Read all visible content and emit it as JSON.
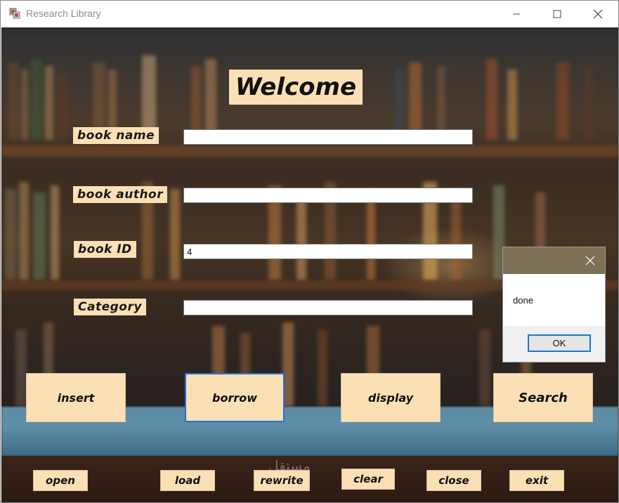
{
  "window": {
    "title": "Research Library",
    "controls": {
      "minimize": "minimize",
      "maximize": "maximize",
      "close": "close"
    }
  },
  "form": {
    "heading": "Welcome",
    "fields": [
      {
        "label": "book name",
        "value": ""
      },
      {
        "label": "book author",
        "value": ""
      },
      {
        "label": "book ID",
        "value": "4"
      },
      {
        "label": "Category",
        "value": ""
      }
    ]
  },
  "actions": {
    "main": [
      "insert",
      "borrow",
      "display",
      "Search"
    ],
    "secondary": [
      "open",
      "load",
      "rewrite",
      "clear",
      "close",
      "exit"
    ]
  },
  "dialog": {
    "message": "done",
    "ok_label": "OK"
  },
  "colors": {
    "label_bg": "#fbe0b5",
    "focus_border": "#1f74d4",
    "dialog_title_bg": "#7e7158"
  }
}
